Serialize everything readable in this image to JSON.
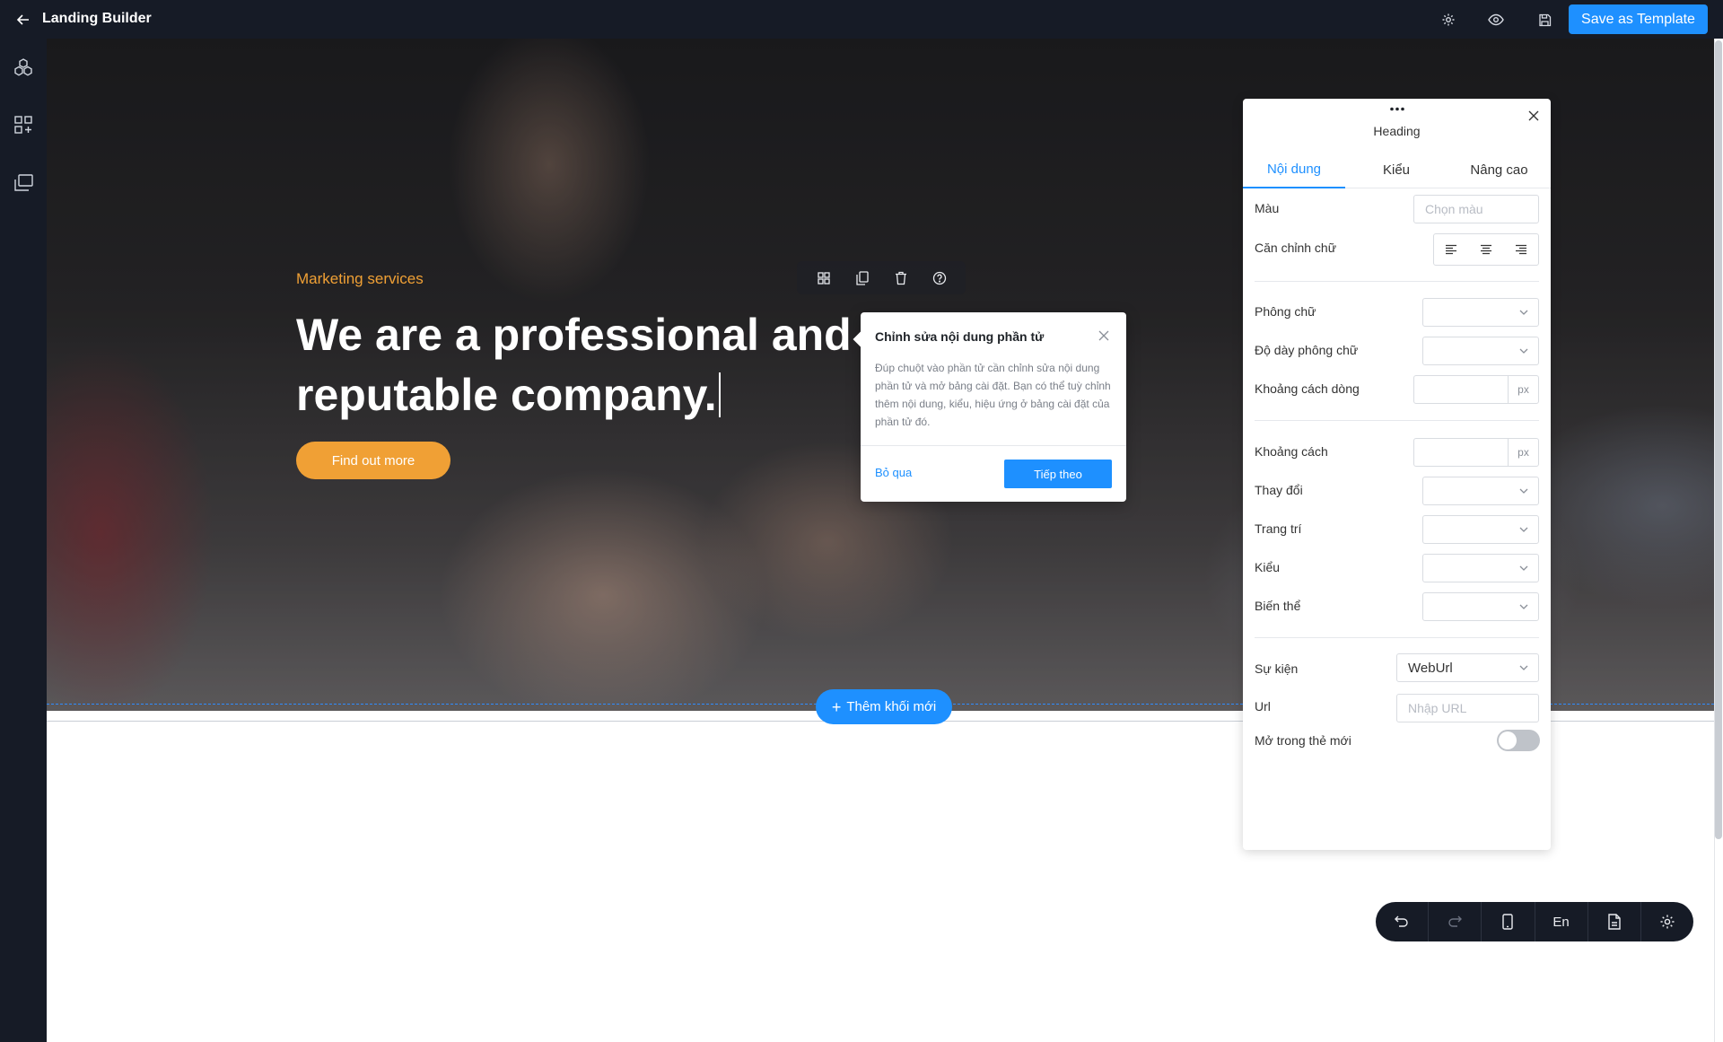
{
  "app": {
    "title": "Landing Builder"
  },
  "header": {
    "save_template_label": "Save as Template",
    "icons": [
      "gear-icon",
      "eye-icon",
      "save-icon"
    ]
  },
  "sidebar": {
    "icons": [
      "blocks-icon",
      "add-widget-icon",
      "pages-icon"
    ]
  },
  "hero": {
    "eyebrow": "Marketing services",
    "heading": "We are a professional and reputable company.",
    "cta_label": "Find out more"
  },
  "element_toolbar": {
    "icons": [
      "grid-icon",
      "duplicate-icon",
      "trash-icon",
      "help-icon"
    ]
  },
  "add_block": {
    "label": "Thêm khối mới"
  },
  "popover": {
    "title": "Chỉnh sửa nội dung phần tử",
    "body": "Đúp chuột vào phần tử cần chỉnh sửa nội dung phần tử và mở bảng cài đặt. Bạn có thể tuỳ chỉnh thêm nội dung, kiểu, hiệu ứng ở bảng cài đặt của phần tử đó.",
    "skip_label": "Bỏ qua",
    "next_label": "Tiếp theo"
  },
  "panel": {
    "title": "Heading",
    "tabs": [
      {
        "label": "Nội dung",
        "active": true
      },
      {
        "label": "Kiểu",
        "active": false
      },
      {
        "label": "Nâng cao",
        "active": false
      }
    ],
    "color": {
      "label": "Màu",
      "placeholder": "Chọn màu"
    },
    "text_align": {
      "label": "Căn chỉnh chữ"
    },
    "font_family": {
      "label": "Phông chữ",
      "value": ""
    },
    "font_weight": {
      "label": "Độ dày phông chữ",
      "value": ""
    },
    "line_height": {
      "label": "Khoảng cách dòng",
      "unit": "px"
    },
    "letter_spacing": {
      "label": "Khoảng cách",
      "unit": "px"
    },
    "transform": {
      "label": "Thay đổi",
      "value": ""
    },
    "decoration": {
      "label": "Trang trí",
      "value": ""
    },
    "style": {
      "label": "Kiểu",
      "value": ""
    },
    "variant": {
      "label": "Biến thể",
      "value": ""
    },
    "event": {
      "label": "Sự kiện",
      "value": "WebUrl"
    },
    "url": {
      "label": "Url",
      "placeholder": "Nhập URL"
    },
    "new_tab": {
      "label": "Mở trong thẻ mới",
      "checked": false
    }
  },
  "bottom_bar": {
    "undo_icon": "undo-icon",
    "redo_icon": "redo-icon",
    "device_icon": "mobile-icon",
    "language": "En",
    "page_icon": "document-icon",
    "settings_icon": "gear-icon"
  },
  "colors": {
    "accent": "#1e90ff",
    "brand_orange": "#f0a035",
    "dark_chrome": "#161b26"
  }
}
